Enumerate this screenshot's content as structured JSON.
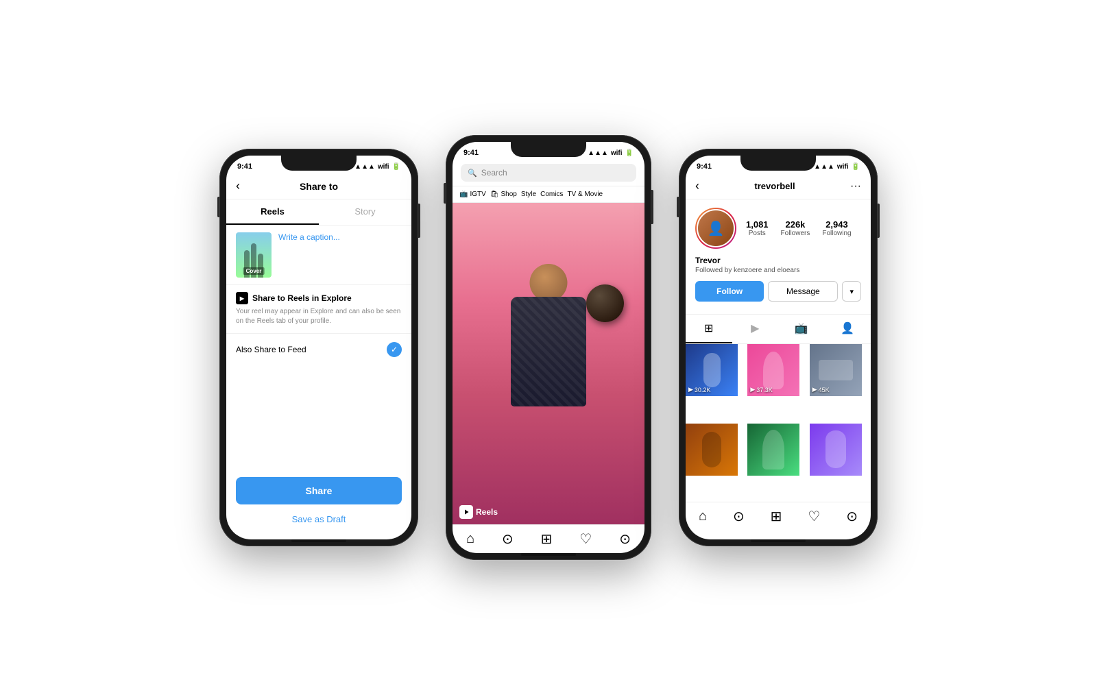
{
  "background": "#ffffff",
  "phone1": {
    "time": "9:41",
    "title": "Share to",
    "back_label": "‹",
    "tabs": [
      "Reels",
      "Story"
    ],
    "active_tab": "Reels",
    "cover_label": "Cover",
    "caption_placeholder": "Write a caption...",
    "reels_explore_title": "Share to Reels in Explore",
    "reels_explore_desc": "Your reel may appear in Explore and can also be seen on the Reels tab of your profile.",
    "also_share_label": "Also Share to Feed",
    "share_button": "Share",
    "save_draft": "Save as Draft"
  },
  "phone2": {
    "time": "9:41",
    "search_placeholder": "Search",
    "categories": [
      "IGTV",
      "Shop",
      "Style",
      "Comics",
      "TV & Movie"
    ],
    "cat_icons": [
      "📺",
      "🛍",
      "",
      "",
      ""
    ],
    "reels_label": "Reels",
    "nav_icons": [
      "⌂",
      "⊙",
      "⊕",
      "♡",
      "⊙"
    ]
  },
  "phone3": {
    "time": "9:41",
    "username": "trevorbell",
    "stats": [
      {
        "num": "1,081",
        "label": "Posts"
      },
      {
        "num": "226k",
        "label": "Followers"
      },
      {
        "num": "2,943",
        "label": "Following"
      }
    ],
    "profile_name": "Trevor",
    "followed_by": "Followed by kenzoere and eloears",
    "follow_button": "Follow",
    "message_button": "Message",
    "video_counts": [
      "30.2K",
      "37.3K",
      "45K",
      "",
      "",
      ""
    ]
  }
}
